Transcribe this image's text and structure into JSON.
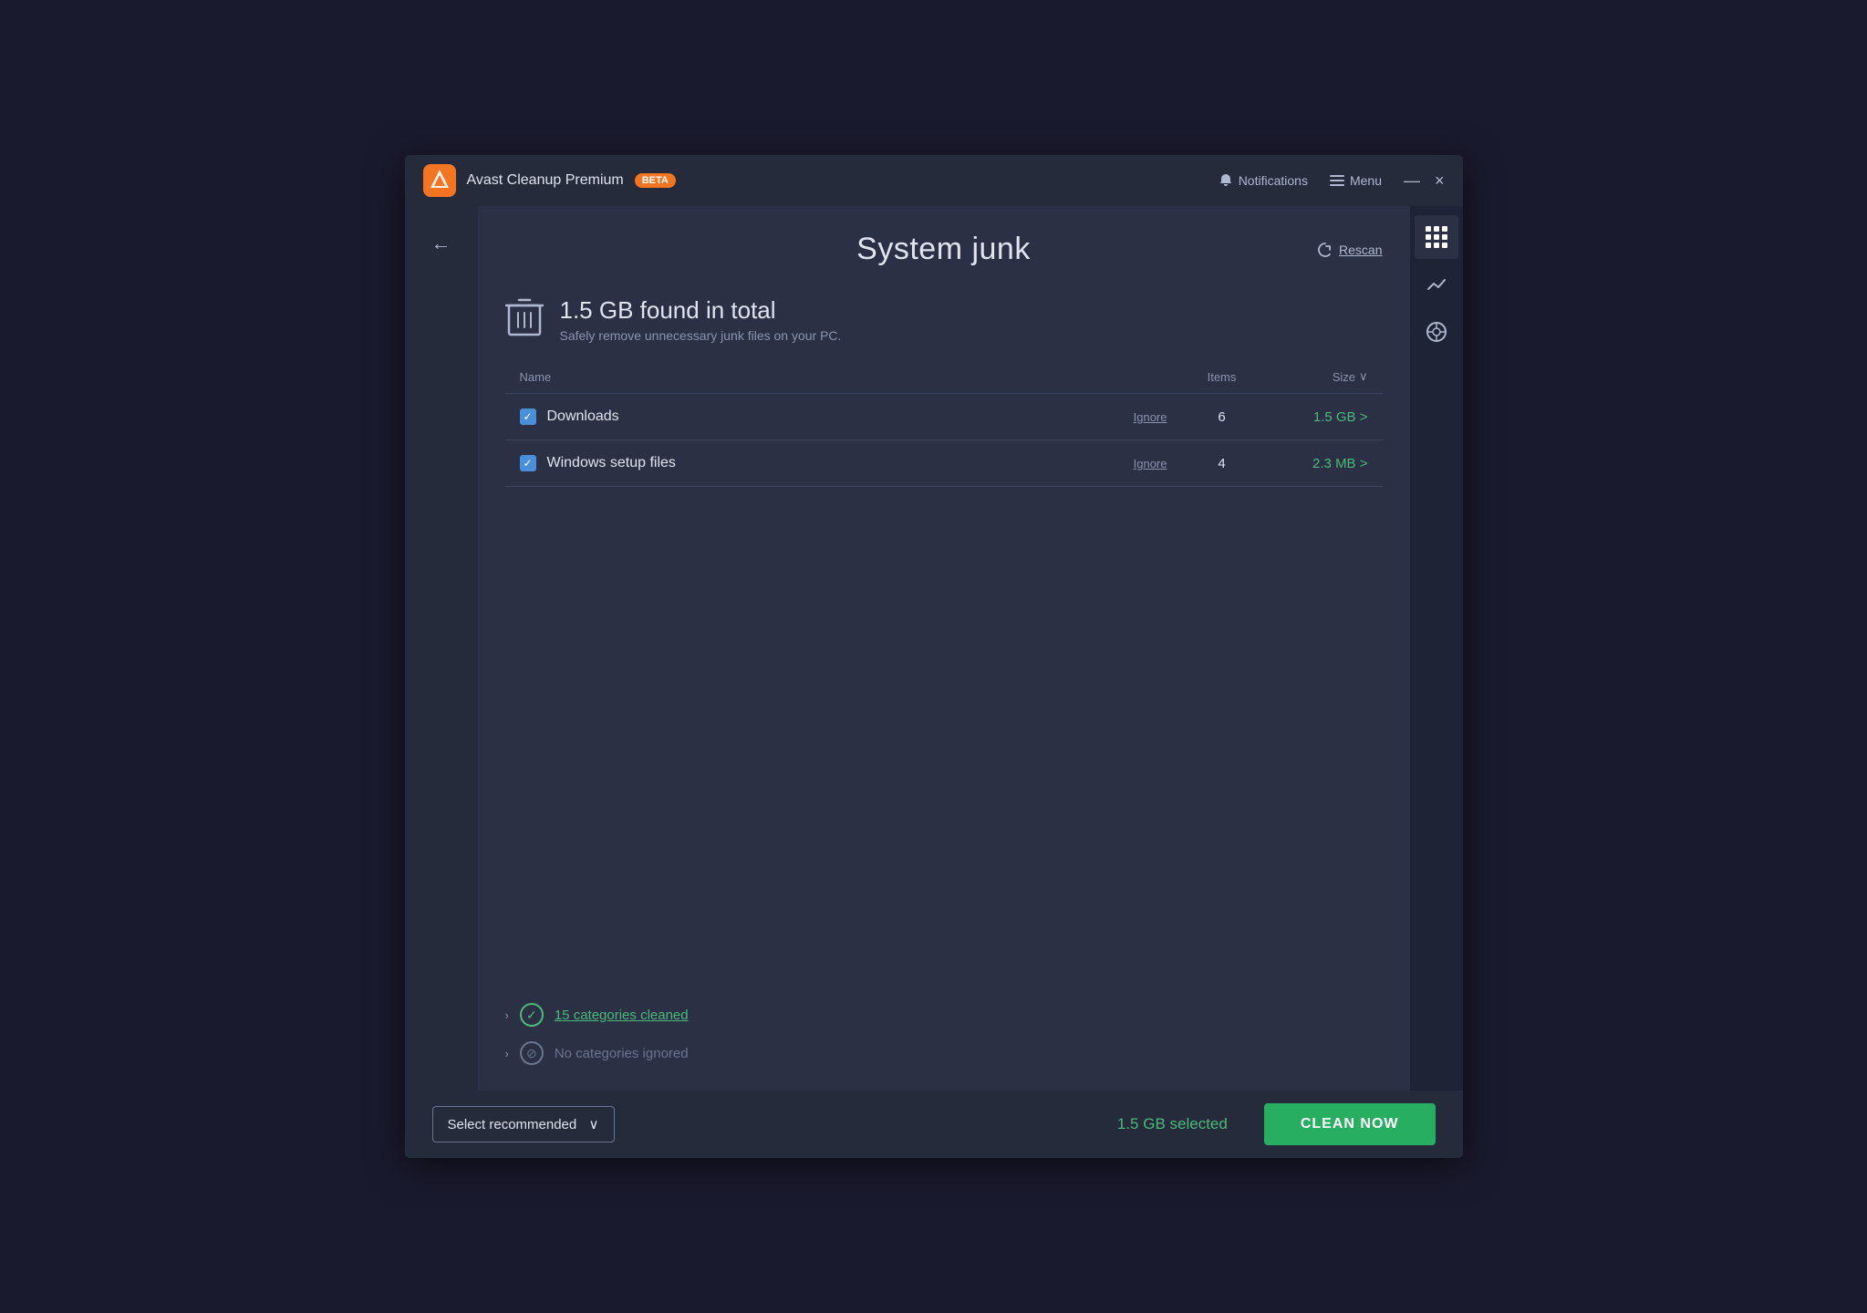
{
  "titleBar": {
    "appName": "Avast Cleanup Premium",
    "betaLabel": "BETA",
    "notifications": "Notifications",
    "menu": "Menu",
    "minimizeBtn": "—",
    "closeBtn": "×"
  },
  "page": {
    "title": "System junk",
    "rescanLabel": "Rescan",
    "summarySize": "1.5 GB found in total",
    "summaryDesc": "Safely remove unnecessary junk files on your PC."
  },
  "table": {
    "columns": {
      "name": "Name",
      "items": "Items",
      "size": "Size"
    },
    "rows": [
      {
        "name": "Downloads",
        "ignoreLabel": "Ignore",
        "items": "6",
        "size": "1.5 GB >"
      },
      {
        "name": "Windows setup files",
        "ignoreLabel": "Ignore",
        "items": "4",
        "size": "2.3 MB >"
      }
    ]
  },
  "categories": [
    {
      "label": "15 categories cleaned",
      "type": "green"
    },
    {
      "label": "No categories ignored",
      "type": "gray"
    }
  ],
  "footer": {
    "selectRecommended": "Select recommended",
    "selectedSize": "1.5 GB selected",
    "cleanNow": "CLEAN NOW"
  }
}
